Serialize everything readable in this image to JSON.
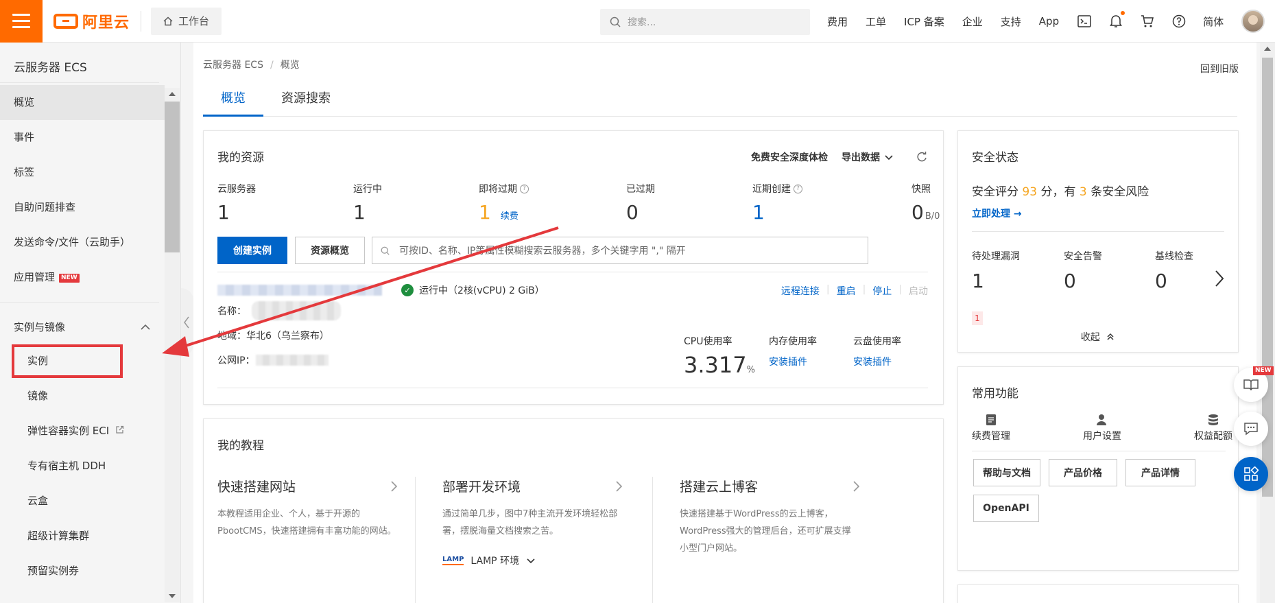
{
  "topbar": {
    "brand": "阿里云",
    "workbench": "工作台",
    "search_placeholder": "搜索...",
    "nav": [
      "费用",
      "工单",
      "ICP 备案",
      "企业",
      "支持",
      "App"
    ],
    "lang": "简体",
    "icons": [
      "terminal-icon",
      "bell-icon",
      "cart-icon",
      "help-icon"
    ]
  },
  "sidebar": {
    "title": "云服务器 ECS",
    "items": [
      "概览",
      "事件",
      "标签",
      "自助问题排查",
      "发送命令/文件（云助手）",
      "应用管理"
    ],
    "new_badge": "NEW",
    "group": "实例与镜像",
    "sub_items": [
      "实例",
      "镜像",
      "弹性容器实例 ECI",
      "专有宿主机 DDH",
      "云盒",
      "超级计算集群",
      "预留实例券"
    ]
  },
  "main": {
    "breadcrumb": [
      "云服务器 ECS",
      "概览"
    ],
    "old_version": "回到旧版",
    "tabs": [
      "概览",
      "资源搜索"
    ]
  },
  "resources": {
    "title": "我的资源",
    "actions": [
      "免费安全深度体检",
      "导出数据"
    ],
    "stats": [
      {
        "label": "云服务器",
        "value": "1"
      },
      {
        "label": "运行中",
        "value": "1"
      },
      {
        "label": "即将过期",
        "value": "1",
        "link": "续费"
      },
      {
        "label": "已过期",
        "value": "0"
      },
      {
        "label": "近期创建",
        "value": "1"
      },
      {
        "label": "快照",
        "value": "0",
        "unit": "B/0"
      }
    ],
    "create_btn": "创建实例",
    "overview_btn": "资源概览",
    "search_placeholder": "可按ID、名称、IP等属性模糊搜索云服务器，多个关键字用 \",\" 隔开",
    "instance": {
      "status": "运行中（2核(vCPU) 2 GiB）",
      "actions": [
        "远程连接",
        "重启",
        "停止",
        "启动"
      ],
      "name_label": "名称：",
      "region": "地域：华北6（乌兰察布）",
      "ip_label": "公网IP：",
      "metrics": [
        {
          "label": "CPU使用率",
          "value": "3.317",
          "unit": "%"
        },
        {
          "label": "内存使用率",
          "link": "安装插件"
        },
        {
          "label": "云盘使用率",
          "link": "安装插件"
        }
      ]
    }
  },
  "tutorials": {
    "title": "我的教程",
    "items": [
      {
        "title": "快速搭建网站",
        "desc": "本教程适用企业、个人，基于开源的PbootCMS，快速搭建拥有丰富功能的网站。"
      },
      {
        "title": "部署开发环境",
        "desc": "通过简单几步，图中7种主流开发环境轻松部署，摆脱海量文档搜索之苦。",
        "env": "LAMP 环境",
        "logo": "LAMP"
      },
      {
        "title": "搭建云上博客",
        "desc": "快速搭建基于WordPress的云上博客，WordPress强大的管理后台，还可扩展支撑小型门户网站。"
      }
    ]
  },
  "security": {
    "title": "安全状态",
    "score_prefix": "安全评分",
    "score": "93",
    "score_mid": "分，有",
    "risks": "3",
    "score_suffix": "条安全风险",
    "link": "立即处理 →",
    "stats": [
      {
        "label": "待处理漏洞",
        "value": "1"
      },
      {
        "label": "安全告警",
        "value": "0"
      },
      {
        "label": "基线检查",
        "value": "0"
      }
    ],
    "badge": "1",
    "collapse": "收起"
  },
  "common": {
    "title": "常用功能",
    "icons": [
      "续费管理",
      "用户设置",
      "权益配额"
    ],
    "chips": [
      "帮助与文档",
      "产品价格",
      "产品详情",
      "OpenAPI"
    ]
  },
  "float": {
    "new_badge": "NEW"
  },
  "colors": {
    "brand": "#ff6a00",
    "primary": "#0064c8",
    "warning": "#f5a623",
    "danger": "#e4393c",
    "success": "#1e8e3e"
  }
}
